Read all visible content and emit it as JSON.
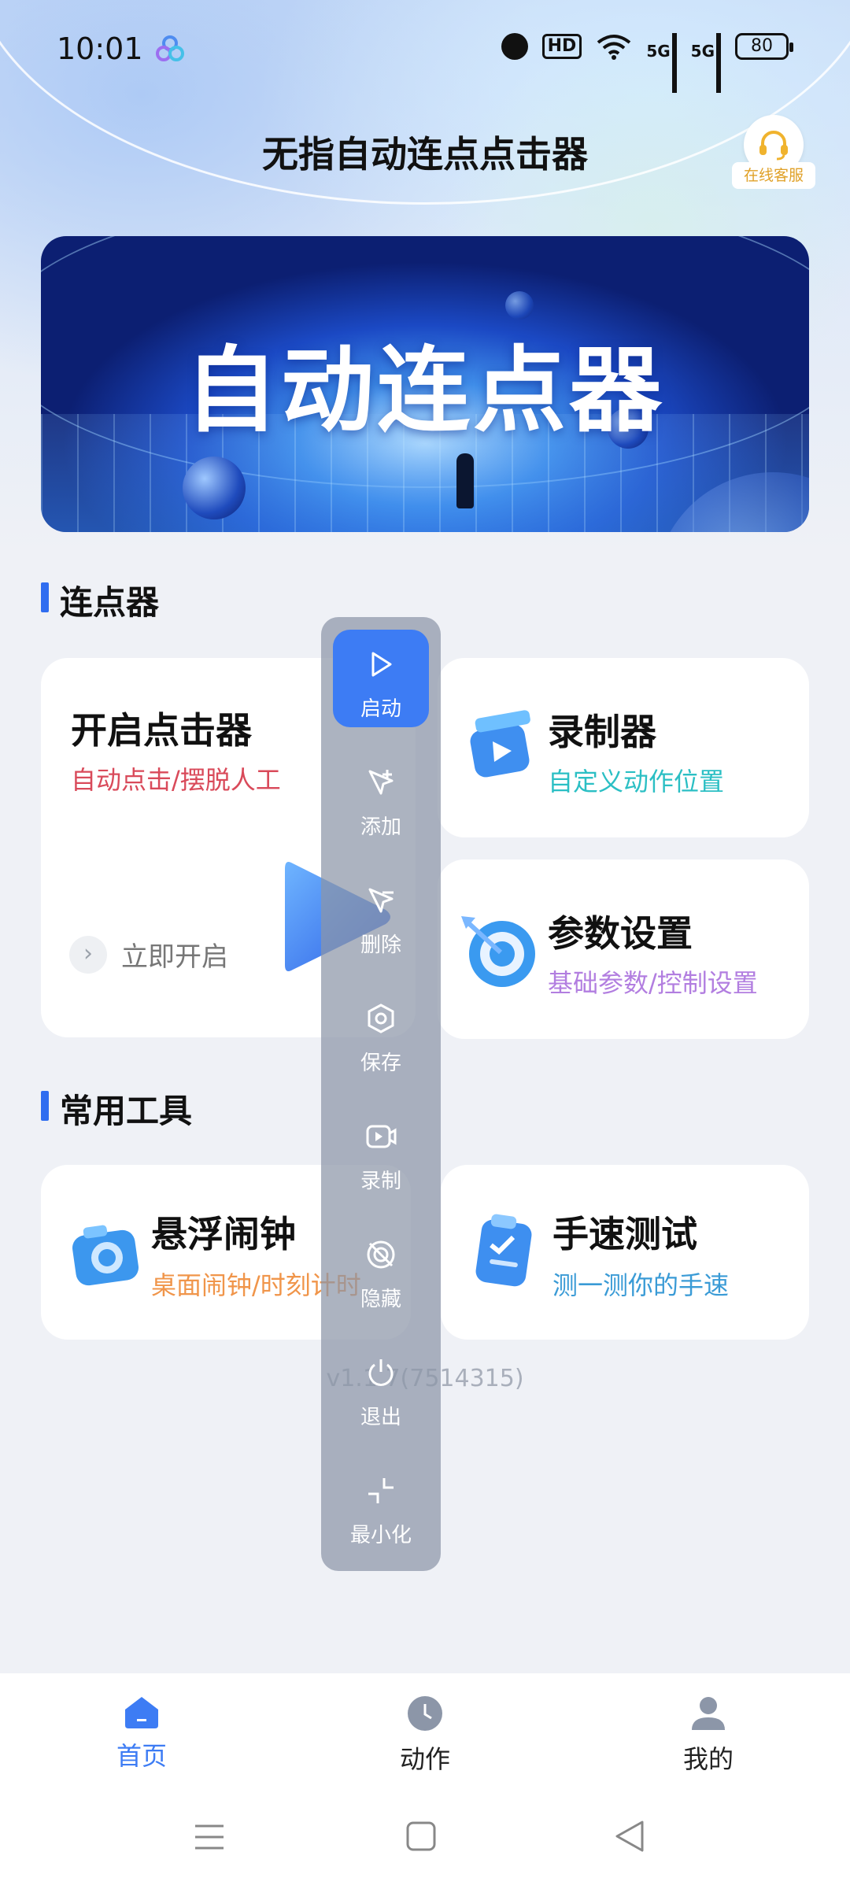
{
  "status_bar": {
    "time": "10:01",
    "hd_label": "HD",
    "net_5g_1": "5G",
    "net_5g_2": "5G",
    "battery": "80"
  },
  "header": {
    "title": "无指自动连点点击器",
    "support_label": "在线客服"
  },
  "banner": {
    "text": "自动连点器"
  },
  "section_clicker": {
    "title": "连点器"
  },
  "card_start": {
    "title": "开启点击器",
    "subtitle": "自动点击/摆脱人工",
    "action": "立即开启"
  },
  "card_recorder": {
    "title": "录制器",
    "subtitle": "自定义动作位置"
  },
  "card_settings": {
    "title": "参数设置",
    "subtitle": "基础参数/控制设置"
  },
  "section_tools": {
    "title": "常用工具"
  },
  "card_alarm": {
    "title": "悬浮闹钟",
    "subtitle": "桌面闹钟/时刻计时"
  },
  "card_speed": {
    "title": "手速测试",
    "subtitle": "测一测你的手速"
  },
  "version": "v1.1.7(7514315)",
  "float_toolbar": {
    "start": "启动",
    "add": "添加",
    "delete": "删除",
    "save": "保存",
    "record": "录制",
    "hide": "隐藏",
    "exit": "退出",
    "minimize": "最小化"
  },
  "bottom_nav": {
    "home": "首页",
    "actions": "动作",
    "mine": "我的"
  },
  "colors": {
    "accent": "#3d7cf4",
    "subtitle_red": "#d94a5a",
    "subtitle_cyan": "#2bbfc4",
    "subtitle_purple": "#b27ee0",
    "subtitle_orange": "#f0954a",
    "subtitle_blue": "#3a9bd6"
  }
}
